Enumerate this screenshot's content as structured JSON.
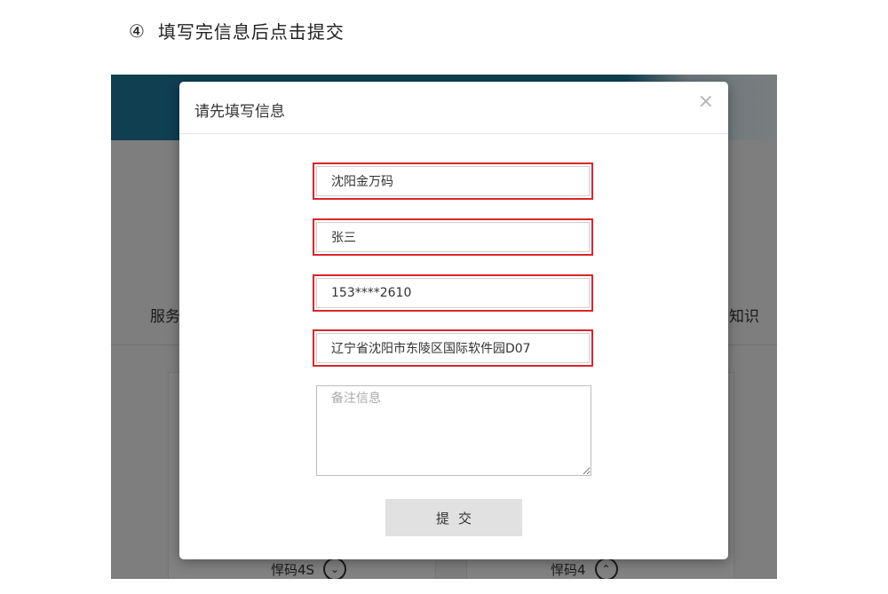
{
  "caption": {
    "number": "④",
    "text": "填写完信息后点击提交"
  },
  "background": {
    "left_text": "服务",
    "right_text": "知识",
    "bottom_left_label": "悍码4S",
    "bottom_right_label": "悍码4",
    "bottom_left_icon": "chevron-down-circle-icon",
    "bottom_right_icon": "chevron-up-circle-icon"
  },
  "modal": {
    "title": "请先填写信息",
    "close": "×",
    "fields": {
      "company": "沈阳金万码",
      "name": "张三",
      "phone": "153****2610",
      "address": "辽宁省沈阳市东陵区国际软件园D07"
    },
    "remark_placeholder": "备注信息",
    "submit_label": "提交"
  },
  "colors": {
    "highlight_border": "#d9262b",
    "banner": "#1d7a9c",
    "button_bg": "#e1e1e1"
  }
}
